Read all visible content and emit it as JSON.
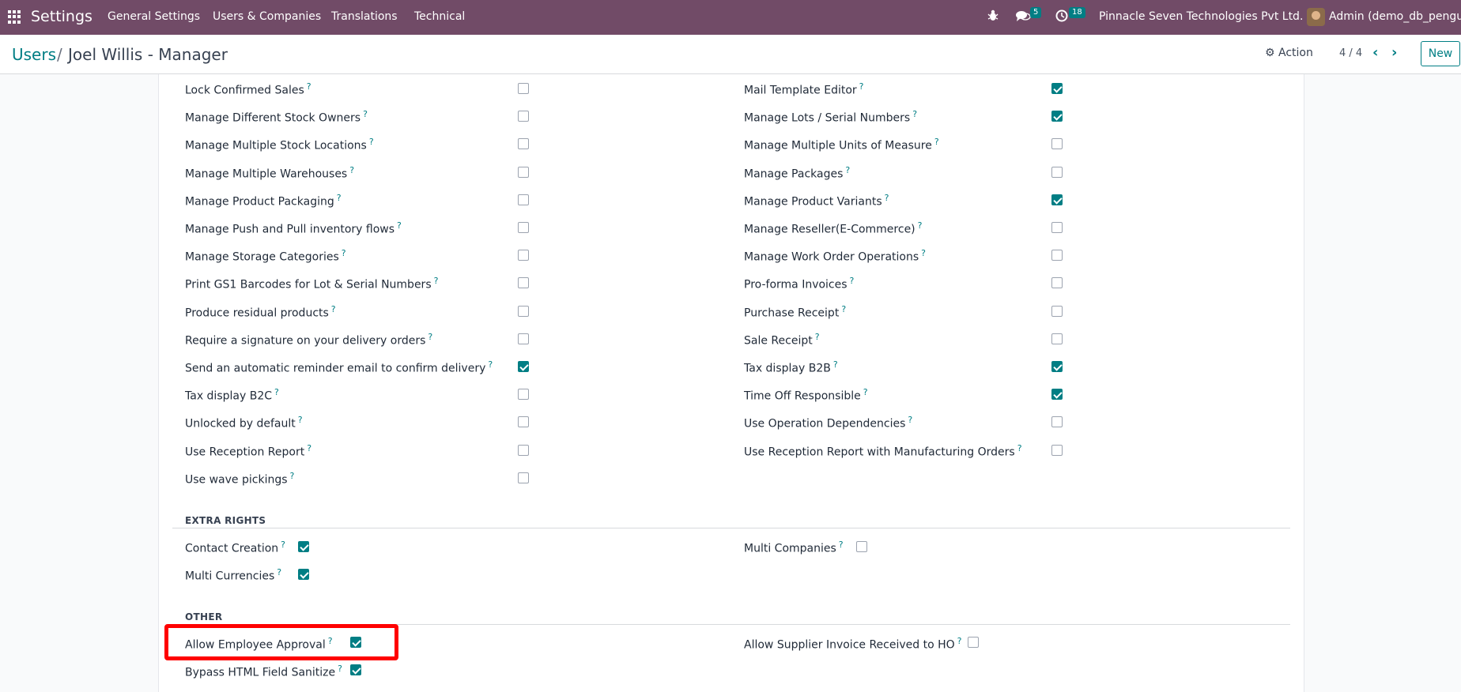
{
  "navbar": {
    "brand": "Settings",
    "menu": [
      "General Settings",
      "Users & Companies",
      "Translations",
      "Technical"
    ],
    "messages_badge": "5",
    "activity_badge": "18",
    "company": "Pinnacle Seven Technologies Pvt Ltd.",
    "user": "Admin (demo_db_penguin"
  },
  "control": {
    "breadcrumb_parent": "Users",
    "breadcrumb_sep": "/",
    "breadcrumb_current": "Joel Willis - Manager",
    "action_label": "Action",
    "pager": "4 / 4",
    "new_label": "New"
  },
  "left_fields": [
    {
      "label": "Lock Confirmed Sales",
      "checked": false
    },
    {
      "label": "Manage Different Stock Owners",
      "checked": false
    },
    {
      "label": "Manage Multiple Stock Locations",
      "checked": false
    },
    {
      "label": "Manage Multiple Warehouses",
      "checked": false
    },
    {
      "label": "Manage Product Packaging",
      "checked": false
    },
    {
      "label": "Manage Push and Pull inventory flows",
      "checked": false
    },
    {
      "label": "Manage Storage Categories",
      "checked": false
    },
    {
      "label": "Print GS1 Barcodes for Lot & Serial Numbers",
      "checked": false
    },
    {
      "label": "Produce residual products",
      "checked": false
    },
    {
      "label": "Require a signature on your delivery orders",
      "checked": false
    },
    {
      "label": "Send an automatic reminder email to confirm delivery",
      "checked": true
    },
    {
      "label": "Tax display B2C",
      "checked": false
    },
    {
      "label": "Unlocked by default",
      "checked": false
    },
    {
      "label": "Use Reception Report",
      "checked": false
    },
    {
      "label": "Use wave pickings",
      "checked": false
    }
  ],
  "right_fields": [
    {
      "label": "Mail Template Editor",
      "checked": true
    },
    {
      "label": "Manage Lots / Serial Numbers",
      "checked": true
    },
    {
      "label": "Manage Multiple Units of Measure",
      "checked": false
    },
    {
      "label": "Manage Packages",
      "checked": false
    },
    {
      "label": "Manage Product Variants",
      "checked": true
    },
    {
      "label": "Manage Reseller(E-Commerce)",
      "checked": false
    },
    {
      "label": "Manage Work Order Operations",
      "checked": false
    },
    {
      "label": "Pro-forma Invoices",
      "checked": false
    },
    {
      "label": "Purchase Receipt",
      "checked": false
    },
    {
      "label": "Sale Receipt",
      "checked": false
    },
    {
      "label": "Tax display B2B",
      "checked": true
    },
    {
      "label": "Time Off Responsible",
      "checked": true
    },
    {
      "label": "Use Operation Dependencies",
      "checked": false
    },
    {
      "label": "Use Reception Report with Manufacturing Orders",
      "checked": false
    }
  ],
  "extra_rights": {
    "title": "EXTRA RIGHTS",
    "fields": [
      {
        "label": "Contact Creation",
        "checked": true
      },
      {
        "label": "Multi Companies",
        "checked": false
      },
      {
        "label": "Multi Currencies",
        "checked": true
      }
    ]
  },
  "other": {
    "title": "OTHER",
    "fields": [
      {
        "label": "Allow Employee Approval",
        "checked": true
      },
      {
        "label": "Allow Supplier Invoice Received to HO",
        "checked": false
      },
      {
        "label": "Bypass HTML Field Sanitize",
        "checked": true
      }
    ]
  },
  "help_marker": "?"
}
